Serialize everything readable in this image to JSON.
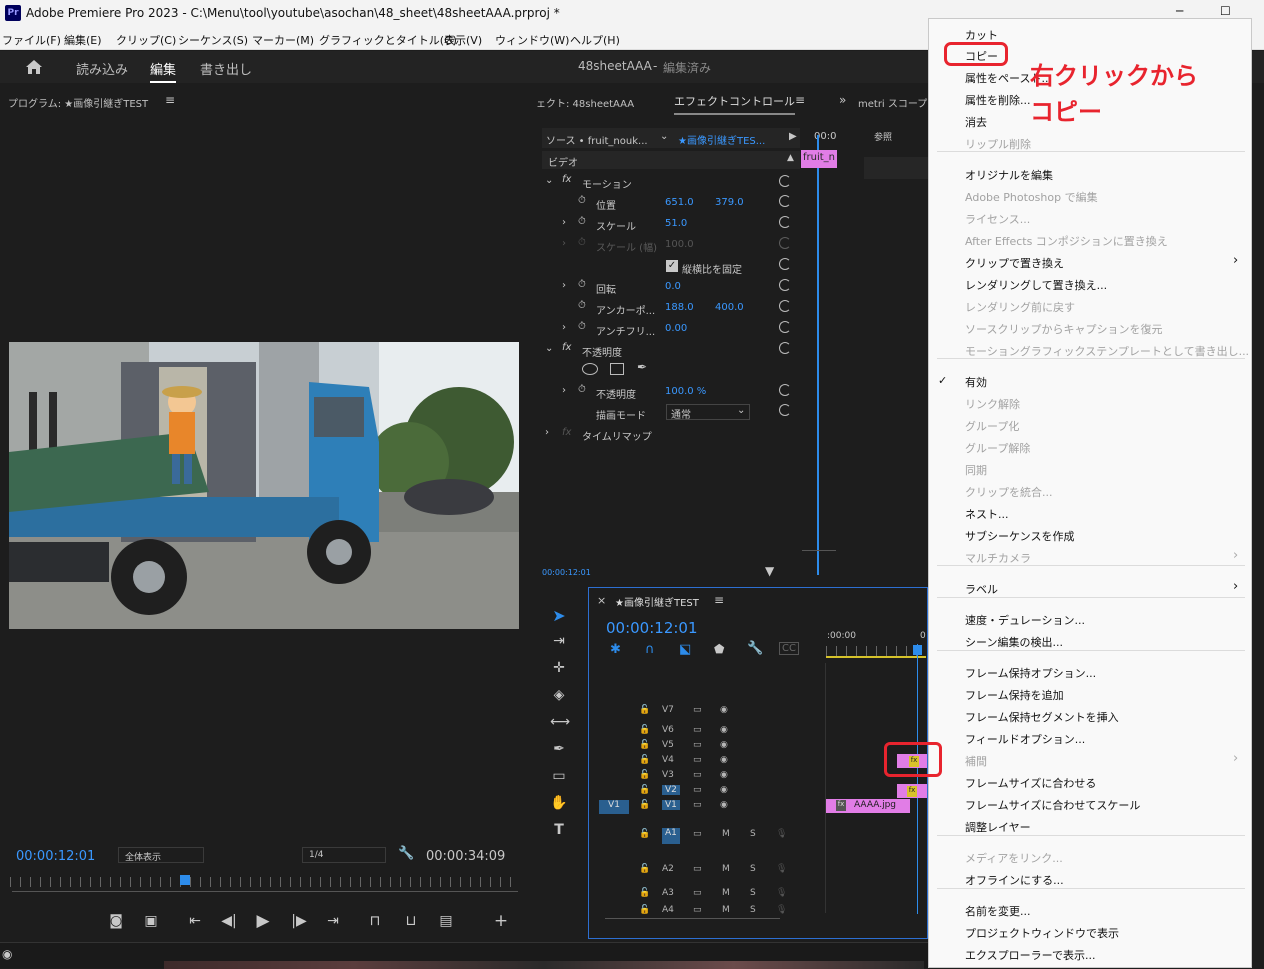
{
  "window": {
    "app_icon": "Pr",
    "title": "Adobe Premiere Pro 2023 - C:\\Menu\\tool\\youtube\\asochan\\48_sheet\\48sheetAAA.prproj *",
    "minimize": "─",
    "maximize": "☐"
  },
  "menubar": [
    "ファイル(F)",
    "編集(E)",
    "クリップ(C)",
    "シーケンス(S)",
    "マーカー(M)",
    "グラフィックとタイトル(G)",
    "表示(V)",
    "ウィンドウ(W)",
    "ヘルプ(H)"
  ],
  "workspace": {
    "tabs": [
      "読み込み",
      "編集",
      "書き出し"
    ],
    "project_name": "48sheetAAA",
    "project_status": "編集済み"
  },
  "program_monitor": {
    "title": "プログラム: ★画像引継ぎTEST",
    "timecode": "00:00:12:01",
    "zoom": "全体表示",
    "resolution": "1/4",
    "duration": "00:00:34:09"
  },
  "effect_controls": {
    "tab_left": "ェクト: 48sheetAAA",
    "tab_active": "エフェクトコントロール",
    "tab_right": "metri スコープ",
    "source": "ソース • fruit_nouk...",
    "sequence": "★画像引継ぎTES...",
    "timeline_tc": "00:0",
    "clip_label": "fruit_n",
    "section_video": "ビデオ",
    "motion": "モーション",
    "position_label": "位置",
    "position_x": "651.0",
    "position_y": "379.0",
    "scale_label": "スケール",
    "scale_value": "51.0",
    "scale_width_label": "スケール (幅)",
    "scale_width_value": "100.0",
    "uniform_scale": "縦横比を固定",
    "rotation_label": "回転",
    "rotation_value": "0.0",
    "anchor_label": "アンカーポ...",
    "anchor_x": "188.0",
    "anchor_y": "400.0",
    "antiflicker_label": "アンチフリ...",
    "antiflicker_value": "0.00",
    "opacity_section": "不透明度",
    "opacity_label": "不透明度",
    "opacity_value": "100.0 %",
    "blend_label": "描画モード",
    "blend_value": "通常",
    "time_remap": "タイムリマップ",
    "footer_tc": "00:00:12:01",
    "right_tab": "参照"
  },
  "timeline": {
    "title": "★画像引継ぎTEST",
    "timecode": "00:00:12:01",
    "ruler_start": ":00:00",
    "ruler_next": "0",
    "video_tracks": [
      "V7",
      "V6",
      "V5",
      "V4",
      "V3",
      "V2",
      "V1"
    ],
    "source_patch": "V1",
    "audio_tracks": [
      "A1",
      "A2",
      "A3",
      "A4"
    ],
    "mute": "M",
    "solo": "S",
    "clip_v1": "AAAA.jpg",
    "fx": "fx"
  },
  "context_menu": {
    "items": [
      {
        "label": "カット",
        "enabled": true
      },
      {
        "label": "コピー",
        "enabled": true,
        "highlighted": true
      },
      {
        "label": "属性をペースト...",
        "enabled": true
      },
      {
        "label": "属性を削除...",
        "enabled": true
      },
      {
        "label": "消去",
        "enabled": true
      },
      {
        "label": "リップル削除",
        "enabled": false
      },
      {
        "label": "オリジナルを編集",
        "enabled": true
      },
      {
        "label": "Adobe Photoshop で編集",
        "enabled": false
      },
      {
        "label": "ライセンス...",
        "enabled": false
      },
      {
        "label": "After Effects コンポジションに置き換え",
        "enabled": false
      },
      {
        "label": "クリップで置き換え",
        "enabled": true,
        "submenu": true
      },
      {
        "label": "レンダリングして置き換え...",
        "enabled": true
      },
      {
        "label": "レンダリング前に戻す",
        "enabled": false
      },
      {
        "label": "ソースクリップからキャプションを復元",
        "enabled": false
      },
      {
        "label": "モーショングラフィックステンプレートとして書き出し...",
        "enabled": false
      },
      {
        "label": "有効",
        "enabled": true,
        "checked": true
      },
      {
        "label": "リンク解除",
        "enabled": false
      },
      {
        "label": "グループ化",
        "enabled": false
      },
      {
        "label": "グループ解除",
        "enabled": false
      },
      {
        "label": "同期",
        "enabled": false
      },
      {
        "label": "クリップを統合...",
        "enabled": false
      },
      {
        "label": "ネスト...",
        "enabled": true
      },
      {
        "label": "サブシーケンスを作成",
        "enabled": true
      },
      {
        "label": "マルチカメラ",
        "enabled": false,
        "submenu": true
      },
      {
        "label": "ラベル",
        "enabled": true,
        "submenu": true
      },
      {
        "label": "速度・デュレーション...",
        "enabled": true
      },
      {
        "label": "シーン編集の検出...",
        "enabled": true
      },
      {
        "label": "フレーム保持オプション...",
        "enabled": true
      },
      {
        "label": "フレーム保持を追加",
        "enabled": true
      },
      {
        "label": "フレーム保持セグメントを挿入",
        "enabled": true
      },
      {
        "label": "フィールドオプション...",
        "enabled": true
      },
      {
        "label": "補間",
        "enabled": false,
        "submenu": true
      },
      {
        "label": "フレームサイズに合わせる",
        "enabled": true
      },
      {
        "label": "フレームサイズに合わせてスケール",
        "enabled": true
      },
      {
        "label": "調整レイヤー",
        "enabled": true
      },
      {
        "label": "メディアをリンク...",
        "enabled": false
      },
      {
        "label": "オフラインにする...",
        "enabled": true
      },
      {
        "label": "名前を変更...",
        "enabled": true
      },
      {
        "label": "プロジェクトウィンドウで表示",
        "enabled": true
      },
      {
        "label": "エクスプローラーで表示...",
        "enabled": true
      }
    ]
  },
  "annotation": {
    "line1": "右クリックから",
    "line2": "コピー",
    "color": "#e8242e"
  },
  "colors": {
    "accent_blue": "#2d8ceb",
    "clip_pink": "#e17de6",
    "highlight_red": "#e8242e"
  }
}
